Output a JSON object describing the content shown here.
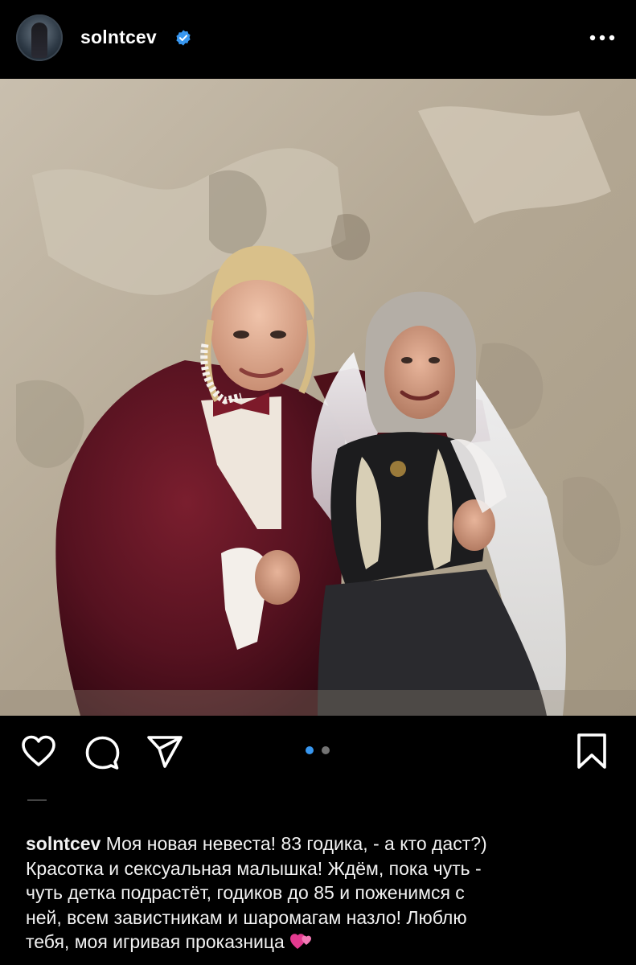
{
  "post": {
    "username": "solntcev",
    "verified": true,
    "more_icon": "more-horizontal-icon",
    "carousel": {
      "total": 2,
      "current": 1,
      "active_color": "#3897f0",
      "inactive_color": "#737373"
    },
    "caption_user": "solntcev",
    "caption_lines": [
      "Моя новая невеста! 83 годика, - а кто даст?)",
      "Красотка и сексуальная малышка! Ждём, пока чуть -",
      "чуть детка подрастёт, годиков до 85 и поженимся с",
      "ней, всем завистникам и шаромагам назло! Люблю",
      "тебя, моя игривая проказница"
    ],
    "caption_emoji": "two-hearts-emoji"
  },
  "actions": {
    "like_icon": "heart-icon",
    "comment_icon": "comment-icon",
    "share_icon": "send-icon",
    "save_icon": "bookmark-icon"
  },
  "colors": {
    "background": "#000000",
    "text": "#ffffff",
    "verified": "#3897f0"
  }
}
